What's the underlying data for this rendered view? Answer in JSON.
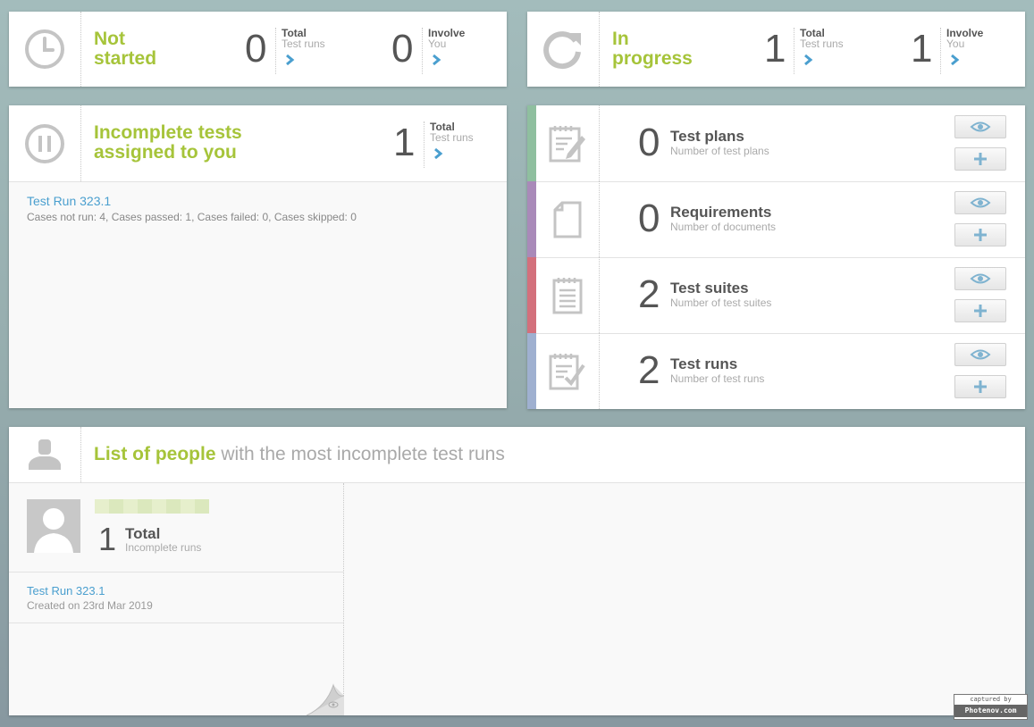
{
  "not_started": {
    "title_line1": "Not",
    "title_line2": "started",
    "total_count": "0",
    "total_label": "Total",
    "total_sub": "Test runs",
    "involve_count": "0",
    "involve_label": "Involve",
    "involve_sub": "You"
  },
  "in_progress": {
    "title_line1": "In",
    "title_line2": "progress",
    "total_count": "1",
    "total_label": "Total",
    "total_sub": "Test runs",
    "involve_count": "1",
    "involve_label": "Involve",
    "involve_sub": "You"
  },
  "incomplete": {
    "title_line1": "Incomplete tests",
    "title_line2": "assigned to you",
    "total_count": "1",
    "total_label": "Total",
    "total_sub": "Test runs",
    "run_name": "Test Run 323.1",
    "run_details": "Cases not run: 4, Cases passed: 1, Cases failed: 0, Cases skipped: 0"
  },
  "summary": [
    {
      "count": "0",
      "title": "Test plans",
      "sub": "Number of test plans",
      "color": "#8fbf9f",
      "icon": "test-plan-icon"
    },
    {
      "count": "0",
      "title": "Requirements",
      "sub": "Number of documents",
      "color": "#a98ab9",
      "icon": "document-icon"
    },
    {
      "count": "2",
      "title": "Test suites",
      "sub": "Number of test suites",
      "color": "#d3707c",
      "icon": "notepad-icon"
    },
    {
      "count": "2",
      "title": "Test runs",
      "sub": "Number of test runs",
      "color": "#9fb0d0",
      "icon": "test-run-icon"
    }
  ],
  "people": {
    "title_green": "List of people",
    "title_rest": "with the most incomplete test runs",
    "person_count": "1",
    "person_total_label": "Total",
    "person_total_sub": "Incomplete runs",
    "run_name": "Test Run 323.1",
    "run_created": "Created on 23rd Mar 2019"
  },
  "watermark": {
    "line1": "captured by",
    "line2": "Photenov.com"
  },
  "colors": {
    "accent_green": "#a6c43a",
    "link_blue": "#4a9fcf",
    "icon_gray": "#c4c4c4"
  }
}
